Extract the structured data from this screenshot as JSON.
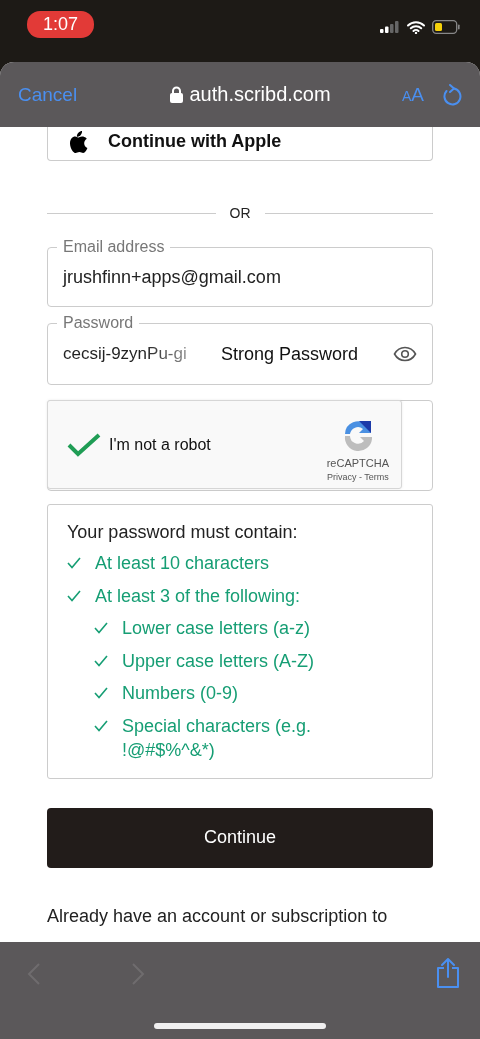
{
  "status_bar": {
    "time": "1:07"
  },
  "browser": {
    "cancel": "Cancel",
    "url": "auth.scribd.com",
    "text_size": "AA"
  },
  "apple_button": "Continue with Apple",
  "divider": "OR",
  "email": {
    "label": "Email address",
    "value": "jrushfinn+apps@gmail.com"
  },
  "password": {
    "label": "Password",
    "value": "cecsij-9zynPu-gi",
    "suggestion": "Strong Password"
  },
  "captcha": {
    "label": "I'm not a robot",
    "checked": true,
    "brand": "reCAPTCHA",
    "links": "Privacy - Terms"
  },
  "requirements": {
    "title": "Your password must contain:",
    "items": [
      {
        "text": "At least 10 characters",
        "met": true
      },
      {
        "text": "At least 3 of the following:",
        "met": true,
        "children": [
          {
            "text": "Lower case letters (a-z)",
            "met": true
          },
          {
            "text": "Upper case letters (A-Z)",
            "met": true
          },
          {
            "text": "Numbers (0-9)",
            "met": true
          },
          {
            "text": "Special characters (e.g. !@#$%^&*)",
            "met": true
          }
        ]
      }
    ]
  },
  "continue_button": "Continue",
  "footer_text": "Already have an account or subscription to",
  "toolbar": {
    "back_disabled": true,
    "forward_disabled": true
  }
}
